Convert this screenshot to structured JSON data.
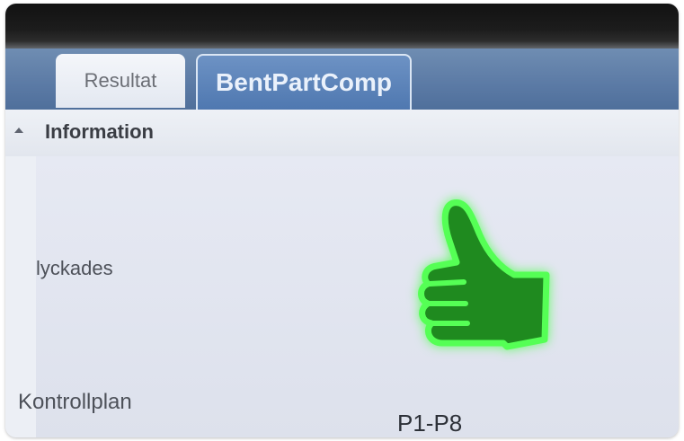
{
  "tabs": [
    {
      "label": "Resultat",
      "active": false
    },
    {
      "label": "BentPartComp",
      "active": true
    }
  ],
  "section": {
    "title": "Information",
    "collapse_icon": "chevron-up-icon"
  },
  "fields": {
    "success_label": "lyckades",
    "success_icon": "thumbs-up-icon",
    "plan_label": "Kontrollplan",
    "plan_value": "P1-P8"
  },
  "colors": {
    "tab_bar": "#5b7aa5",
    "active_tab": "#4f78b0",
    "thumb_fill": "#1f8a1f",
    "thumb_glow": "#4dff4d"
  }
}
